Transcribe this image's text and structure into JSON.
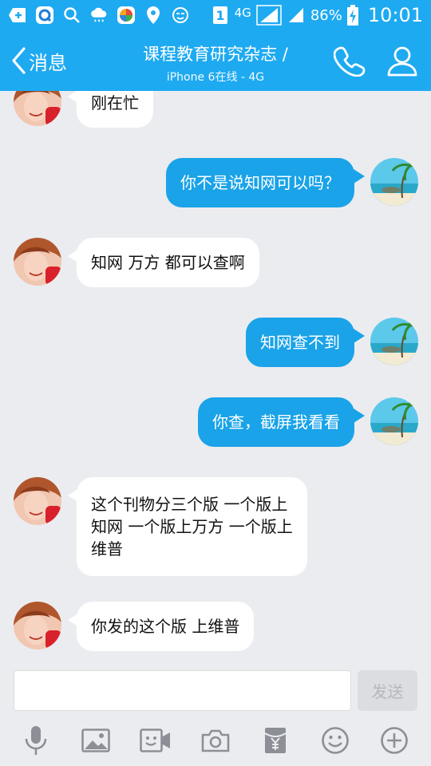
{
  "status_bar": {
    "network": "4G",
    "sim_slot": "1",
    "battery_percent": "86%",
    "time": "10:01"
  },
  "nav": {
    "back_label": "消息",
    "title": "课程教育研究杂志 /",
    "subtitle": "iPhone 6在线 - 4G"
  },
  "messages": [
    {
      "direction": "in",
      "text": "刚在忙"
    },
    {
      "direction": "out",
      "text": "你不是说知网可以吗？"
    },
    {
      "direction": "in",
      "text": "知网 万方 都可以查啊"
    },
    {
      "direction": "out",
      "text": "知网查不到"
    },
    {
      "direction": "out",
      "text": "你查，截屏我看看"
    },
    {
      "direction": "in",
      "lines": [
        "这个刊物分三个版 一个版上",
        "知网 一个版上万方 一个版上",
        "维普"
      ]
    },
    {
      "direction": "in",
      "text": "你发的这个版 上维普"
    }
  ],
  "input": {
    "value": "",
    "send_label": "发送"
  },
  "toolbar": {
    "icons": [
      "microphone-icon",
      "image-icon",
      "video-message-icon",
      "camera-icon",
      "red-packet-icon",
      "emoji-icon",
      "plus-icon"
    ]
  },
  "colors": {
    "header_blue": "#1eaaf1",
    "outgoing_bubble": "#1aa3e8",
    "incoming_bubble": "#ffffff",
    "background": "#ebecf0"
  }
}
